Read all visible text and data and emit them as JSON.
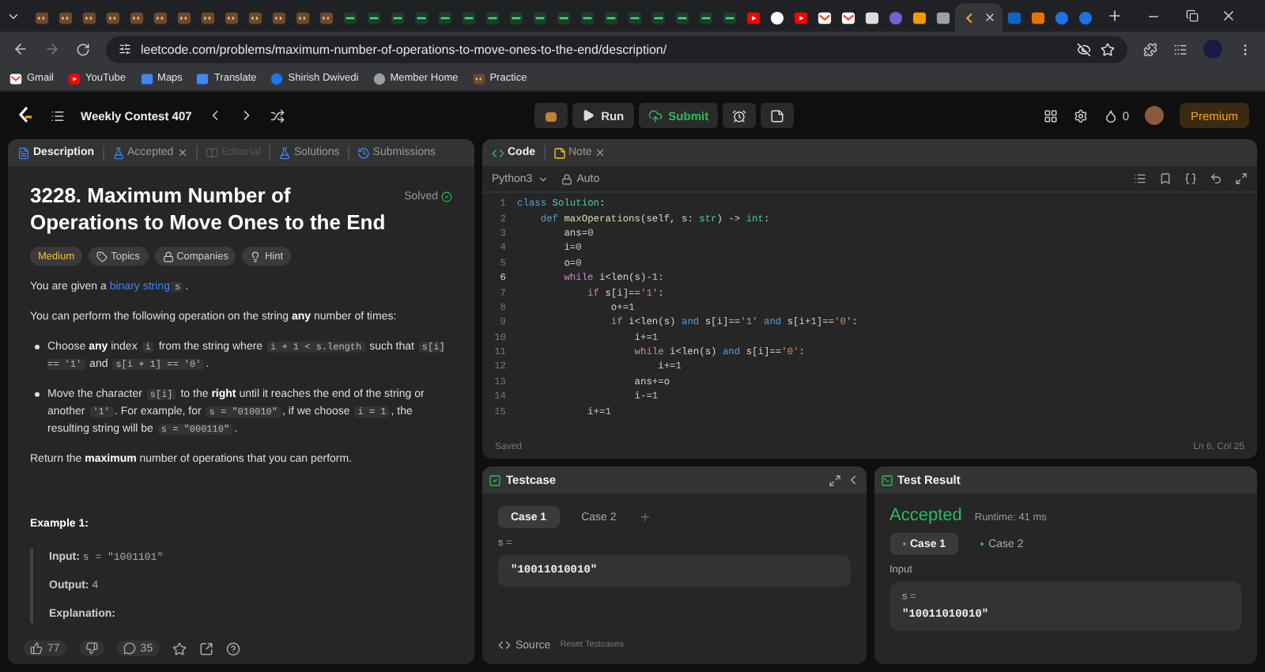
{
  "browser": {
    "tabs": [
      {
        "kind": "cc",
        "selected": false
      },
      {
        "kind": "cc",
        "selected": false
      },
      {
        "kind": "cc",
        "selected": false
      },
      {
        "kind": "cc",
        "selected": false
      },
      {
        "kind": "cc",
        "selected": false
      },
      {
        "kind": "cc",
        "selected": false
      },
      {
        "kind": "cc",
        "selected": false
      },
      {
        "kind": "cc",
        "selected": false
      },
      {
        "kind": "cc",
        "selected": false
      },
      {
        "kind": "cc",
        "selected": false
      },
      {
        "kind": "cc",
        "selected": false
      },
      {
        "kind": "cc",
        "selected": false
      },
      {
        "kind": "cc",
        "selected": false
      },
      {
        "kind": "green",
        "selected": false
      },
      {
        "kind": "green",
        "selected": false
      },
      {
        "kind": "green",
        "selected": false
      },
      {
        "kind": "green",
        "selected": false
      },
      {
        "kind": "green",
        "selected": false
      },
      {
        "kind": "green",
        "selected": false
      },
      {
        "kind": "green",
        "selected": false
      },
      {
        "kind": "green",
        "selected": false
      },
      {
        "kind": "green",
        "selected": false
      },
      {
        "kind": "green",
        "selected": false
      },
      {
        "kind": "green",
        "selected": false
      },
      {
        "kind": "green",
        "selected": false
      },
      {
        "kind": "green",
        "selected": false
      },
      {
        "kind": "green",
        "selected": false
      },
      {
        "kind": "green",
        "selected": false
      },
      {
        "kind": "green",
        "selected": false
      },
      {
        "kind": "green",
        "selected": false
      },
      {
        "kind": "youtube",
        "selected": false
      },
      {
        "kind": "github",
        "selected": false
      },
      {
        "kind": "youtube",
        "selected": false
      },
      {
        "kind": "gmail",
        "selected": false
      },
      {
        "kind": "gmail",
        "selected": false
      },
      {
        "kind": "gpt",
        "selected": false
      },
      {
        "kind": "ring",
        "selected": false
      },
      {
        "kind": "chart",
        "selected": false
      },
      {
        "kind": "cloud",
        "selected": false
      },
      {
        "kind": "leetcode",
        "selected": true
      },
      {
        "kind": "linkedin",
        "selected": false
      },
      {
        "kind": "orange",
        "selected": false
      },
      {
        "kind": "blue",
        "selected": false
      },
      {
        "kind": "blue",
        "selected": false
      }
    ],
    "url": "leetcode.com/problems/maximum-number-of-operations-to-move-ones-to-the-end/description/",
    "bookmarks": [
      {
        "label": "Gmail",
        "kind": "gmail"
      },
      {
        "label": "YouTube",
        "kind": "youtube"
      },
      {
        "label": "Maps",
        "kind": "maps"
      },
      {
        "label": "Translate",
        "kind": "translate"
      },
      {
        "label": "Shirish Dwivedi",
        "kind": "facebook"
      },
      {
        "label": "Member Home",
        "kind": "globe"
      },
      {
        "label": "Practice",
        "kind": "cc"
      }
    ]
  },
  "header": {
    "contest": "Weekly Contest 407",
    "run": "Run",
    "submit": "Submit",
    "streak": "0",
    "premium": "Premium"
  },
  "left_tabs": [
    {
      "label": "Description",
      "selected": true,
      "disabled": false,
      "closable": false
    },
    {
      "label": "Accepted",
      "selected": false,
      "disabled": false,
      "closable": true
    },
    {
      "label": "Editorial",
      "selected": false,
      "disabled": true,
      "closable": false
    },
    {
      "label": "Solutions",
      "selected": false,
      "disabled": false,
      "closable": false
    },
    {
      "label": "Submissions",
      "selected": false,
      "disabled": false,
      "closable": false
    }
  ],
  "problem": {
    "title": "3228. Maximum Number of Operations to Move Ones to the End",
    "status": "Solved",
    "tags": [
      {
        "label": "Medium",
        "kind": "difficulty"
      },
      {
        "label": "Topics",
        "kind": "topics"
      },
      {
        "label": "Companies",
        "kind": "companies"
      },
      {
        "label": "Hint",
        "kind": "hint"
      }
    ],
    "paragraphs": [
      {
        "kind": "p",
        "segments": [
          {
            "kind": "text",
            "text": "You are given a "
          },
          {
            "kind": "link",
            "text": "binary string"
          },
          {
            "kind": "code",
            "text": "s"
          },
          {
            "kind": "text",
            "text": "."
          }
        ]
      },
      {
        "kind": "p",
        "segments": [
          {
            "kind": "text",
            "text": "You can perform the following operation on the string "
          },
          {
            "kind": "bold",
            "text": "any"
          },
          {
            "kind": "text",
            "text": " number of times:"
          }
        ]
      },
      {
        "kind": "bullet",
        "segments": [
          {
            "kind": "text",
            "text": "Choose "
          },
          {
            "kind": "bold",
            "text": "any"
          },
          {
            "kind": "text",
            "text": " index "
          },
          {
            "kind": "code",
            "text": "i"
          },
          {
            "kind": "text",
            "text": " from the string where "
          },
          {
            "kind": "code",
            "text": "i + 1 < s.length"
          },
          {
            "kind": "text",
            "text": " such that "
          },
          {
            "kind": "code",
            "text": "s[i] == '1'"
          },
          {
            "kind": "text",
            "text": " and "
          },
          {
            "kind": "code",
            "text": "s[i + 1] == '0'"
          },
          {
            "kind": "text",
            "text": "."
          }
        ]
      },
      {
        "kind": "bullet",
        "segments": [
          {
            "kind": "text",
            "text": "Move the character "
          },
          {
            "kind": "code",
            "text": "s[i]"
          },
          {
            "kind": "text",
            "text": " to the "
          },
          {
            "kind": "bold",
            "text": "right"
          },
          {
            "kind": "text",
            "text": " until it reaches the end of the string or another "
          },
          {
            "kind": "code",
            "text": "'1'"
          },
          {
            "kind": "text",
            "text": ". For example, for "
          },
          {
            "kind": "code",
            "text": "s = \"010010\""
          },
          {
            "kind": "text",
            "text": ", if we choose "
          },
          {
            "kind": "code",
            "text": "i = 1"
          },
          {
            "kind": "text",
            "text": ", the resulting string will be "
          },
          {
            "kind": "code",
            "text": "s = \"000110\""
          },
          {
            "kind": "text",
            "text": "."
          }
        ]
      },
      {
        "kind": "p",
        "segments": [
          {
            "kind": "text",
            "text": "Return the "
          },
          {
            "kind": "bold",
            "text": "maximum"
          },
          {
            "kind": "text",
            "text": " number of operations that you can perform."
          }
        ]
      }
    ],
    "example": {
      "heading": "Example 1:",
      "input_label": "Input:",
      "input": "s = \"1001101\"",
      "output_label": "Output:",
      "output": "4",
      "explanation_label": "Explanation:"
    },
    "likes": "77",
    "comments": "35"
  },
  "code": {
    "tabs": [
      {
        "label": "Code",
        "selected": true,
        "closable": false
      },
      {
        "label": "Note",
        "selected": false,
        "closable": true
      }
    ],
    "language": "Python3",
    "mode": "Auto",
    "lines": [
      {
        "n": "1",
        "active": false,
        "tokens": [
          {
            "kind": "kw",
            "t": "class"
          },
          {
            "kind": "type",
            "t": " Solution"
          },
          {
            "kind": "plain",
            "t": ":"
          }
        ]
      },
      {
        "n": "2",
        "active": false,
        "tokens": [
          {
            "kind": "kw",
            "t": "    def"
          },
          {
            "kind": "fn",
            "t": " maxOperations"
          },
          {
            "kind": "plain",
            "t": "(self, s: "
          },
          {
            "kind": "type",
            "t": "str"
          },
          {
            "kind": "plain",
            "t": ") -> "
          },
          {
            "kind": "type",
            "t": "int"
          },
          {
            "kind": "plain",
            "t": ":"
          }
        ]
      },
      {
        "n": "3",
        "active": false,
        "tokens": [
          {
            "kind": "plain",
            "t": "        ans="
          },
          {
            "kind": "num",
            "t": "0"
          }
        ]
      },
      {
        "n": "4",
        "active": false,
        "tokens": [
          {
            "kind": "plain",
            "t": "        i="
          },
          {
            "kind": "num",
            "t": "0"
          }
        ]
      },
      {
        "n": "5",
        "active": false,
        "tokens": [
          {
            "kind": "plain",
            "t": "        o="
          },
          {
            "kind": "num",
            "t": "0"
          }
        ]
      },
      {
        "n": "6",
        "active": true,
        "tokens": [
          {
            "kind": "ctl",
            "t": "        while"
          },
          {
            "kind": "plain",
            "t": " i<len(s)-"
          },
          {
            "kind": "num",
            "t": "1"
          },
          {
            "kind": "plain",
            "t": ":"
          }
        ]
      },
      {
        "n": "7",
        "active": false,
        "tokens": [
          {
            "kind": "ctl",
            "t": "            if"
          },
          {
            "kind": "plain",
            "t": " s[i]=="
          },
          {
            "kind": "str",
            "t": "'1'"
          },
          {
            "kind": "plain",
            "t": ":"
          }
        ]
      },
      {
        "n": "8",
        "active": false,
        "tokens": [
          {
            "kind": "plain",
            "t": "                o+="
          },
          {
            "kind": "num",
            "t": "1"
          }
        ]
      },
      {
        "n": "9",
        "active": false,
        "tokens": [
          {
            "kind": "ctl",
            "t": "                if"
          },
          {
            "kind": "plain",
            "t": " i<len(s) "
          },
          {
            "kind": "kw",
            "t": "and"
          },
          {
            "kind": "plain",
            "t": " s[i]=="
          },
          {
            "kind": "str",
            "t": "'1'"
          },
          {
            "kind": "kw",
            "t": " and"
          },
          {
            "kind": "plain",
            "t": " s[i+"
          },
          {
            "kind": "num",
            "t": "1"
          },
          {
            "kind": "plain",
            "t": "]=="
          },
          {
            "kind": "str",
            "t": "'0'"
          },
          {
            "kind": "plain",
            "t": ":"
          }
        ]
      },
      {
        "n": "10",
        "active": false,
        "tokens": [
          {
            "kind": "plain",
            "t": "                    i+="
          },
          {
            "kind": "num",
            "t": "1"
          }
        ]
      },
      {
        "n": "11",
        "active": false,
        "tokens": [
          {
            "kind": "ctl",
            "t": "                    while"
          },
          {
            "kind": "plain",
            "t": " i<len(s) "
          },
          {
            "kind": "kw",
            "t": "and"
          },
          {
            "kind": "plain",
            "t": " s[i]=="
          },
          {
            "kind": "str",
            "t": "'0'"
          },
          {
            "kind": "plain",
            "t": ":"
          }
        ]
      },
      {
        "n": "12",
        "active": false,
        "tokens": [
          {
            "kind": "plain",
            "t": "                        i+="
          },
          {
            "kind": "num",
            "t": "1"
          }
        ]
      },
      {
        "n": "13",
        "active": false,
        "tokens": [
          {
            "kind": "plain",
            "t": "                    ans+=o"
          }
        ]
      },
      {
        "n": "14",
        "active": false,
        "tokens": [
          {
            "kind": "plain",
            "t": "                    i-="
          },
          {
            "kind": "num",
            "t": "1"
          }
        ]
      },
      {
        "n": "15",
        "active": false,
        "tokens": [
          {
            "kind": "plain",
            "t": "            i+="
          },
          {
            "kind": "num",
            "t": "1"
          }
        ]
      }
    ],
    "status": "Saved",
    "position": "Ln 6, Col 25"
  },
  "testcase": {
    "title": "Testcase",
    "cases": [
      {
        "label": "Case 1",
        "selected": true
      },
      {
        "label": "Case 2",
        "selected": false
      }
    ],
    "var": "s =",
    "value": "\"10011010010\"",
    "source": "Source",
    "reset": "Reset Testcases"
  },
  "result": {
    "title": "Test Result",
    "status": "Accepted",
    "runtime": "Runtime: 41 ms",
    "cases": [
      {
        "label": "Case 1",
        "selected": true
      },
      {
        "label": "Case 2",
        "selected": false
      }
    ],
    "input_label": "Input",
    "var": "s =",
    "value": "\"10011010010\""
  }
}
